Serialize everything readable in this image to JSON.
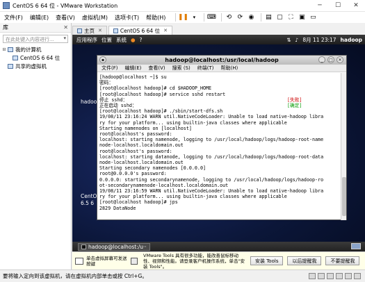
{
  "window": {
    "title": "CentOS 6 64 位 - VMware Workstation"
  },
  "menu": {
    "items": [
      "文件(F)",
      "编辑(E)",
      "查看(V)",
      "虚拟机(M)",
      "选项卡(T)",
      "帮助(H)"
    ]
  },
  "library": {
    "title": "库",
    "search_placeholder": "在此处键入内容进行...",
    "tree": [
      {
        "label": "我的计算机",
        "level": 0
      },
      {
        "label": "CentOS 6 64 位",
        "level": 1
      },
      {
        "label": "共享的虚拟机",
        "level": 0
      }
    ]
  },
  "tabs": [
    {
      "label": "主页",
      "active": false
    },
    {
      "label": "CentOS 6 64 位",
      "active": true
    }
  ],
  "guest": {
    "top_panel": {
      "apps": "应用程序",
      "places": "位置",
      "system": "系统",
      "clock": "8月 11 23:17",
      "user": "hadoop"
    },
    "desktop_labels": [
      "hadoo",
      "CentO",
      "6.5 6"
    ],
    "terminal": {
      "title": "hadoop@localhost:/usr/local/hadoop",
      "menu": [
        "文件(F)",
        "编辑(E)",
        "查看(V)",
        "搜索 (S)",
        "终端(T)",
        "帮助(H)"
      ],
      "lines": [
        {
          "text": "[hadoop@localhost ~]$ su"
        },
        {
          "text": "密码："
        },
        {
          "text": "[root@localhost hadoop]# cd $HADOOP_HOME"
        },
        {
          "text": "[root@localhost hadoop]# service sshd restart"
        },
        {
          "text": "停止 sshd：",
          "status": "[失败]",
          "status_class": "fail"
        },
        {
          "text": "正在启动 sshd：",
          "status": "[确定]",
          "status_class": "ok"
        },
        {
          "text": "[root@localhost hadoop]# ./sbin/start-dfs.sh"
        },
        {
          "text": "19/08/11 23:16:24 WARN util.NativeCodeLoader: Unable to load native-hadoop libra"
        },
        {
          "text": "ry for your platform... using builtin-java classes where applicable"
        },
        {
          "text": "Starting namenodes on [localhost]"
        },
        {
          "text": "root@localhost's password:"
        },
        {
          "text": "localhost: starting namenode, logging to /usr/local/hadoop/logs/hadoop-root-name"
        },
        {
          "text": "node-localhost.localdomain.out"
        },
        {
          "text": "root@localhost's password:"
        },
        {
          "text": "localhost: starting datanode, logging to /usr/local/hadoop/logs/hadoop-root-data"
        },
        {
          "text": "node-localhost.localdomain.out"
        },
        {
          "text": "Starting secondary namenodes [0.0.0.0]"
        },
        {
          "text": "root@0.0.0.0's password:"
        },
        {
          "text": "0.0.0.0: starting secondarynamenode, logging to /usr/local/hadoop/logs/hadoop-ro"
        },
        {
          "text": "ot-secondarynamenode-localhost.localdomain.out"
        },
        {
          "text": "19/08/11 23:16:59 WARN util.NativeCodeLoader: Unable to load native-hadoop libra"
        },
        {
          "text": "ry for your platform... using builtin-java classes where applicable"
        },
        {
          "text": "[root@localhost hadoop]# jps"
        },
        {
          "text": "2829 DataNode"
        }
      ]
    },
    "taskbar": {
      "task_label": "hadoop@localhost:/u··"
    }
  },
  "hintbar": {
    "hint1": "单击虚拟屏幕可发送按键",
    "hint2": "VMware Tools 具有很多功能，能改善鼠标移动性、视频和性能。请登录客户机操作系统，单击\"安装 Tools\"。",
    "buttons": [
      "安装 Tools",
      "以后提醒我",
      "不要提醒我"
    ]
  },
  "status": {
    "text": "要将输入定向到该虚拟机，请在虚拟机内部单击或按 Ctrl+G。"
  }
}
